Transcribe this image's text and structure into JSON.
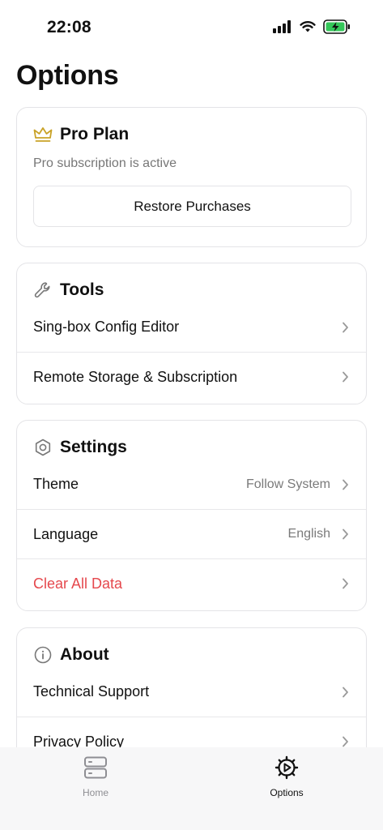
{
  "status_bar": {
    "time": "22:08"
  },
  "page": {
    "title": "Options"
  },
  "pro": {
    "title": "Pro Plan",
    "status": "Pro subscription is active",
    "restore_label": "Restore Purchases",
    "accent": "#c9a227"
  },
  "tools": {
    "title": "Tools",
    "items": [
      {
        "label": "Sing-box Config Editor"
      },
      {
        "label": "Remote Storage & Subscription"
      }
    ]
  },
  "settings": {
    "title": "Settings",
    "items": [
      {
        "label": "Theme",
        "value": "Follow System"
      },
      {
        "label": "Language",
        "value": "English"
      },
      {
        "label": "Clear All Data",
        "color": "#e5484d"
      }
    ]
  },
  "about": {
    "title": "About",
    "items": [
      {
        "label": "Technical Support"
      },
      {
        "label": "Privacy Policy"
      }
    ]
  },
  "tab_bar": {
    "tabs": [
      {
        "label": "Home",
        "icon": "server-stack-icon",
        "active": false
      },
      {
        "label": "Options",
        "icon": "gear-play-icon",
        "active": true
      }
    ]
  },
  "colors": {
    "battery": "#34c759",
    "danger": "#e5484d",
    "border": "#e4e4e7"
  }
}
